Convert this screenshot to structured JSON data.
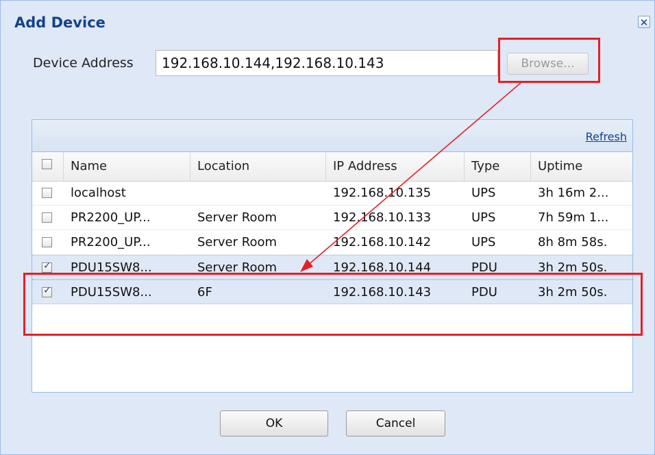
{
  "dialog": {
    "title": "Add Device",
    "close_glyph": "✕"
  },
  "address": {
    "label": "Device Address",
    "value": "192.168.10.144,192.168.10.143"
  },
  "browse_label": "Browse...",
  "grid": {
    "refresh_label": "Refresh",
    "columns": [
      "Name",
      "Location",
      "IP Address",
      "Type",
      "Uptime"
    ],
    "rows": [
      {
        "name": "localhost",
        "location": "",
        "ip": "192.168.10.135",
        "type": "UPS",
        "uptime": "3h 16m 2...",
        "checked": false
      },
      {
        "name": "PR2200_UP...",
        "location": "Server Room",
        "ip": "192.168.10.133",
        "type": "UPS",
        "uptime": "7h 59m 1...",
        "checked": false
      },
      {
        "name": "PR2200_UP...",
        "location": "Server Room",
        "ip": "192.168.10.142",
        "type": "UPS",
        "uptime": "8h 8m 58s.",
        "checked": false
      },
      {
        "name": "PDU15SW8...",
        "location": "Server Room",
        "ip": "192.168.10.144",
        "type": "PDU",
        "uptime": "3h 2m 50s.",
        "checked": true
      },
      {
        "name": "PDU15SW8...",
        "location": "6F",
        "ip": "192.168.10.143",
        "type": "PDU",
        "uptime": "3h 2m 50s.",
        "checked": true
      }
    ]
  },
  "buttons": {
    "ok": "OK",
    "cancel": "Cancel"
  },
  "colors": {
    "highlight": "#e32027",
    "title": "#15428b",
    "selected_row": "#dfe8f6"
  }
}
